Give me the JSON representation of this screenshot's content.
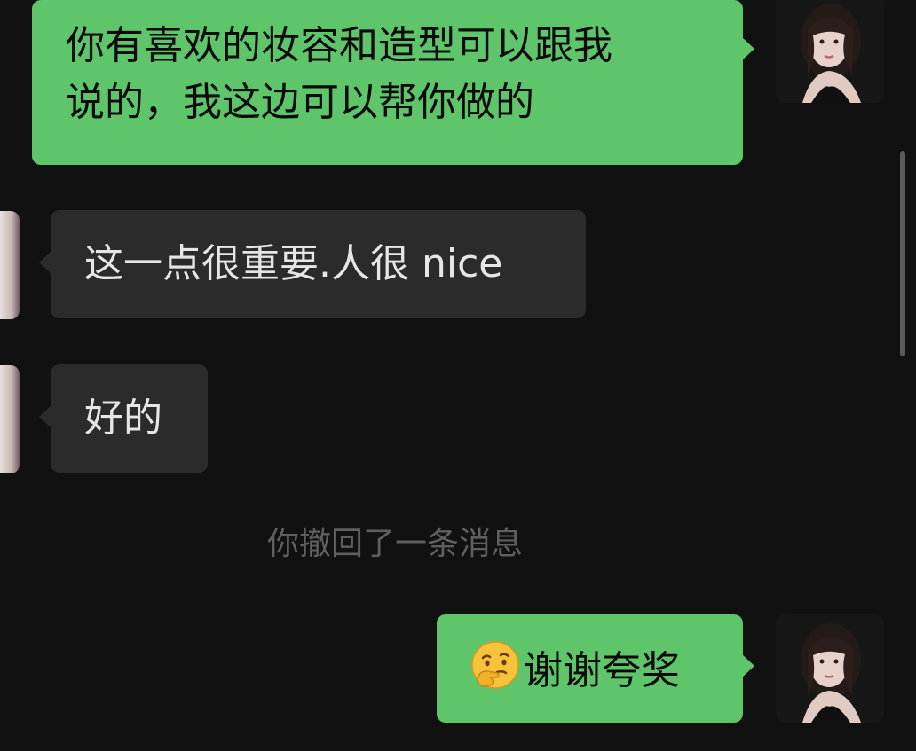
{
  "messages": [
    {
      "id": "m1",
      "side": "out",
      "lines": [
        "你有喜欢的妆容和造型可以跟我",
        "说的，我这边可以帮你做的"
      ]
    },
    {
      "id": "m2",
      "side": "in",
      "text": "这一点很重要.人很 nice"
    },
    {
      "id": "m3",
      "side": "in",
      "text": "好的"
    },
    {
      "id": "m4",
      "side": "system",
      "text": "你撤回了一条消息"
    },
    {
      "id": "m5",
      "side": "out",
      "emoji": "thinking-face-icon",
      "text": "谢谢夸奖"
    }
  ],
  "colors": {
    "background": "#111111",
    "outgoing_bubble": "#5ec56a",
    "incoming_bubble": "#2b2b2b",
    "system_text": "#5f5f5f"
  }
}
